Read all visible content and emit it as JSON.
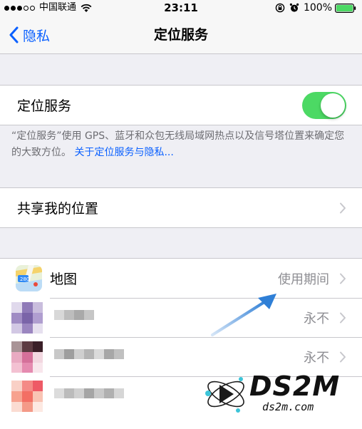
{
  "status_bar": {
    "carrier": "中国联通",
    "time": "23:11",
    "battery": "100%"
  },
  "nav": {
    "back_label": "隐私",
    "title": "定位服务"
  },
  "location_services": {
    "label": "定位服务",
    "toggle_on": true,
    "footer_text": "“定位服务”使用 GPS、蓝牙和众包无线局域网热点以及信号塔位置来确定您的大致方位。",
    "footer_link": "关于定位服务与隐私..."
  },
  "share_location": {
    "label": "共享我的位置"
  },
  "apps": [
    {
      "name": "地图",
      "value": "使用期间"
    },
    {
      "name": "",
      "value": "永不"
    },
    {
      "name": "",
      "value": "永不"
    },
    {
      "name": "",
      "value": ""
    }
  ],
  "watermark": {
    "logo": "DS2M",
    "url": "ds2m.com"
  },
  "colors": {
    "accent": "#0a60ff",
    "toggle_on": "#4cd964",
    "annotation_arrow": "#2f7fd6"
  }
}
